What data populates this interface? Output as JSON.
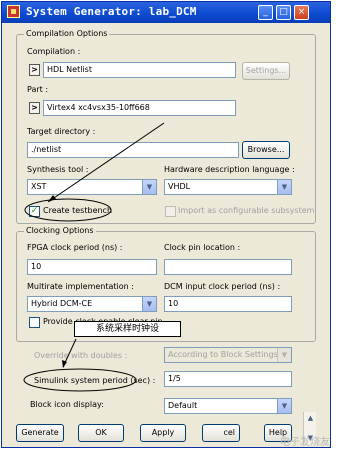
{
  "window": {
    "title": "System Generator: lab_DCM",
    "controls": [
      "_",
      "□",
      "×"
    ]
  },
  "compilation": {
    "group_title": "Compilation Options",
    "compilation_label": "Compilation :",
    "compilation_value": "HDL Netlist",
    "settings_button": "Settings...",
    "part_label": "Part :",
    "part_value": "Virtex4  xc4vsx35-10ff668",
    "target_label": "Target directory :",
    "target_value": "./netlist",
    "browse_button": "Browse...",
    "synthesis_label": "Synthesis tool :",
    "synthesis_value": "XST",
    "hdl_label": "Hardware description language :",
    "hdl_value": "VHDL",
    "testbench_label": "Create testbench",
    "import_label": "Import as configurable subsystem",
    "expand_glyph": ">"
  },
  "clocking": {
    "group_title": "Clocking Options",
    "fpga_period_label": "FPGA clock period (ns) :",
    "fpga_period_value": "10",
    "clock_pin_label": "Clock pin location :",
    "clock_pin_value": "",
    "multirate_label": "Multirate implementation :",
    "multirate_value": "Hybrid DCM-CE",
    "dcm_period_label": "DCM input clock period (ns) :",
    "dcm_period_value": "10",
    "clear_pin_label": "Provide clock enable clear pin"
  },
  "override": {
    "label": "Override with doubles :",
    "value": "According to Block Settings"
  },
  "simulink": {
    "label": "Simulink system period (sec) :",
    "value": "1/5"
  },
  "block_icon": {
    "label": "Block icon display:",
    "value": "Default"
  },
  "annotation": {
    "text": "系统采样时钟设"
  },
  "buttons": {
    "generate": "Generate",
    "ok": "OK",
    "apply": "Apply",
    "cancel": "cel",
    "help": "Help"
  },
  "icons": {
    "checkmark": "✓",
    "dropdown": "▼",
    "scroll_up": "▲",
    "scroll_down": "▼"
  },
  "watermark": "电子发烧友"
}
